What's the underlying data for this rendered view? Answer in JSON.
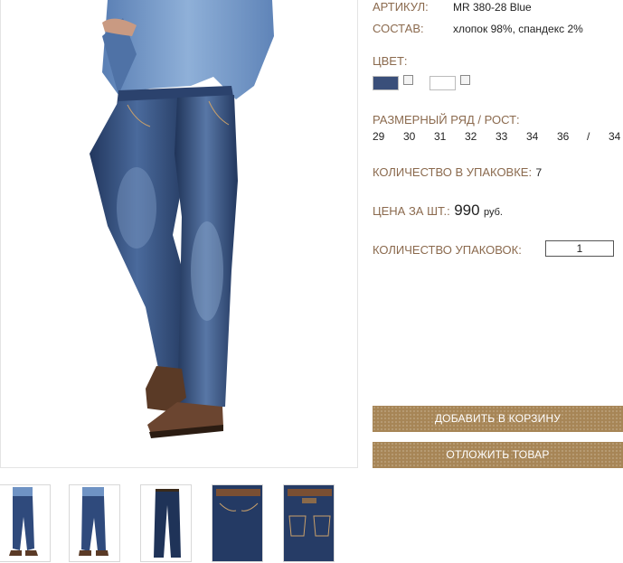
{
  "product": {
    "article_label": "АРТИКУЛ:",
    "article_value": "MR 380-28 Blue",
    "composition_label": "СОСТАВ:",
    "composition_value": "хлопок 98%, спандекс 2%",
    "color_label": "ЦВЕТ:",
    "colors": [
      {
        "name": "denim-blue",
        "hex": "#3a4f7a",
        "checked": false
      },
      {
        "name": "white",
        "hex": "#ffffff",
        "checked": false
      }
    ],
    "sizes_label": "РАЗМЕРНЫЙ РЯД / РОСТ:",
    "sizes": [
      "29",
      "30",
      "31",
      "32",
      "33",
      "34",
      "36",
      "/",
      "34"
    ],
    "pack_qty_label": "КОЛИЧЕСТВО В УПАКОВКЕ:",
    "pack_qty_value": "7",
    "price_label": "ЦЕНА ЗА ШТ.:",
    "price_value": "990",
    "price_currency": "руб.",
    "packs_label": "КОЛИЧЕСТВО УПАКОВОК:",
    "packs_value": "1",
    "add_to_cart": "ДОБАВИТЬ В КОРЗИНУ",
    "postpone": "ОТЛОЖИТЬ ТОВАР"
  },
  "colors": {
    "label": "#8b6a4e",
    "button": "#a78556",
    "denim": "#2f4a7c",
    "denim_dark": "#1f3358",
    "shirt": "#6f93c4",
    "shoe": "#5a3a26"
  },
  "thumbnails": [
    "jeans-full-view-1",
    "jeans-full-view-2",
    "jeans-flat-front",
    "jeans-waist-front",
    "jeans-waist-back"
  ]
}
